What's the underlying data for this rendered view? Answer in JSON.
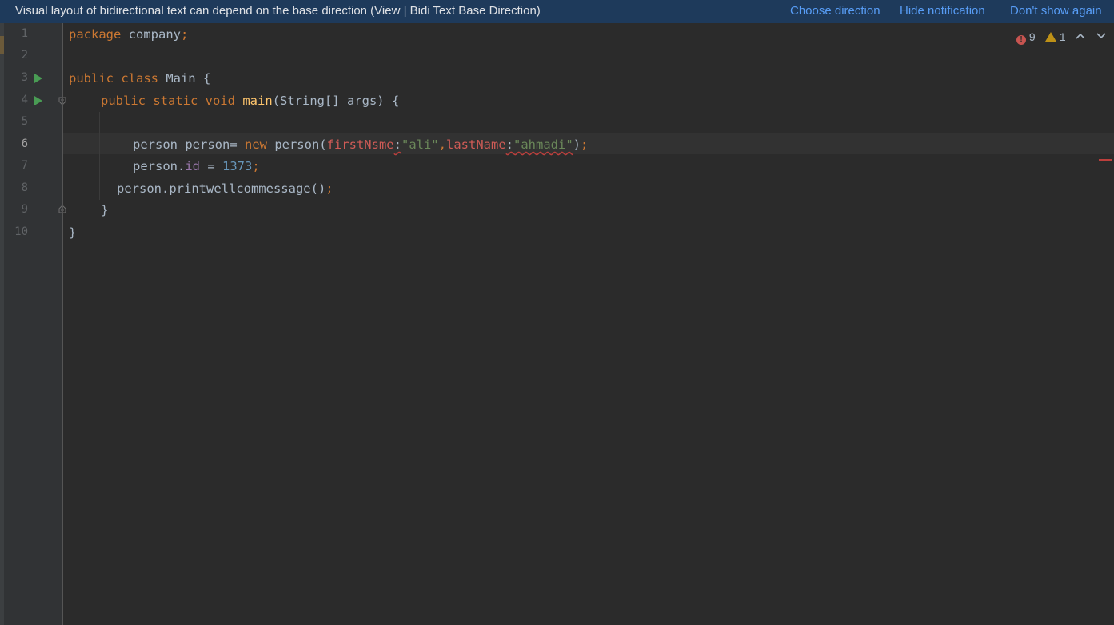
{
  "notification": {
    "message": "Visual layout of bidirectional text can depend on the base direction (View | Bidi Text Base Direction)",
    "actions": {
      "choose": "Choose direction",
      "hide": "Hide notification",
      "dont_show": "Don't show again"
    }
  },
  "gutter": {
    "line_numbers": [
      "1",
      "2",
      "3",
      "4",
      "5",
      "6",
      "7",
      "8",
      "9",
      "10"
    ],
    "current_line": "6"
  },
  "inspections": {
    "errors": "9",
    "warnings": "1",
    "prev_icon": "chevron-up-icon",
    "next_icon": "chevron-down-icon"
  },
  "code": {
    "l1": {
      "kw": "package",
      "rest": " company",
      "semi": ";"
    },
    "l3": {
      "kw": "public class",
      "rest": " Main {"
    },
    "l4": {
      "kw": "public static void",
      "sp": " ",
      "fn": "main",
      "rest": "(String[] args) {"
    },
    "l6": {
      "t1": "person person= ",
      "kw": "new",
      "t2": " person(",
      "h1": "firstNsme",
      "c1": ":",
      "s1": "\"ali\"",
      "comma": ",",
      "h2": "lastName",
      "c2": ":",
      "s2": "\"ahmadi\"",
      "t3": ")",
      "semi": ";"
    },
    "l7": {
      "t1": "person.",
      "fld": "id",
      "t2": " = ",
      "num": "1373",
      "semi": ";"
    },
    "l8": {
      "t1": "person.printwellcommessage()",
      "semi": ";"
    },
    "l9": {
      "t1": "}"
    },
    "l10": {
      "t1": "}"
    }
  },
  "colors": {
    "background": "#2b2b2b",
    "keyword": "#cc7832",
    "string": "#6a8759",
    "number": "#6897bb",
    "function": "#ffc66d",
    "error": "#bc3f3c",
    "notification_bg": "#1e3a5b",
    "link": "#589df6"
  }
}
